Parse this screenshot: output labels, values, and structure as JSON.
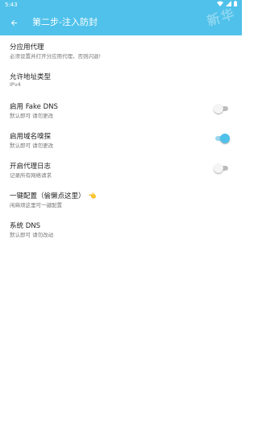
{
  "status_bar": {
    "time": "5:43",
    "icons": [
      "wifi-icon",
      "signal-icon",
      "battery-icon"
    ]
  },
  "app_bar": {
    "title": "第二步-注入防封",
    "back_icon": "arrow-left-icon",
    "background_color": "#4fc1ea"
  },
  "watermark": {
    "text": "新华"
  },
  "settings": [
    {
      "id": "split-app-proxy",
      "title": "分应用代理",
      "summary": "必须设置并打开分应用代理，否则闪退!"
    },
    {
      "id": "allowed-address-type",
      "title": "允许地址类型",
      "summary": "IPv4"
    },
    {
      "id": "fake-dns",
      "title": "启用 Fake DNS",
      "summary": "默认即可 请勿更改",
      "toggle": false
    },
    {
      "id": "domain-sniffing",
      "title": "启用域名嗅探",
      "summary": "默认即可 请勿更改",
      "toggle": true
    },
    {
      "id": "proxy-log",
      "title": "开启代理日志",
      "summary": "记录所有网络请求",
      "toggle": false
    },
    {
      "id": "one-click-config",
      "title": "一键配置（偷懒点这里）",
      "summary": "闲麻烦这里可一键配置",
      "emoji": "👈"
    },
    {
      "id": "system-dns",
      "title": "系统 DNS",
      "summary": "默认即可 请勿改动"
    }
  ],
  "colors": {
    "accent": "#4fc1ea",
    "toggle_off_track": "#bdbdbd",
    "primary_text": "#222222",
    "secondary_text": "#777777"
  }
}
